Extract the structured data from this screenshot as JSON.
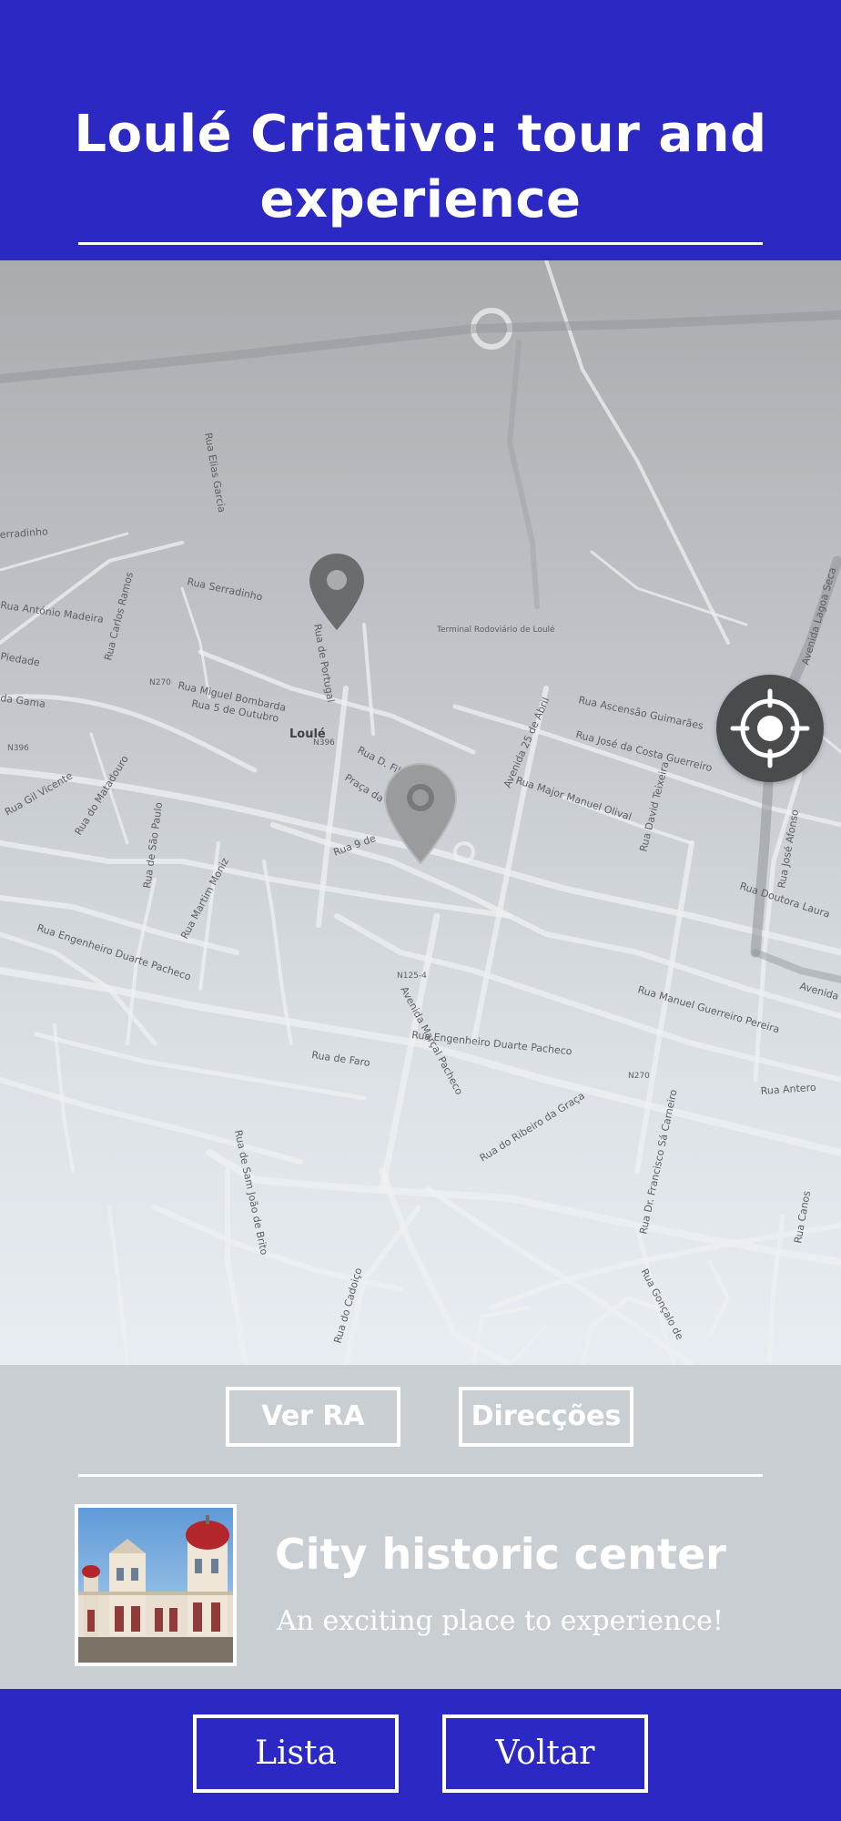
{
  "theme": {
    "brand_color": "#2b28c4",
    "map_pin_color": "#6b6c6e",
    "active_pin_color": "#9a9b9d"
  },
  "header": {
    "title": "Loulé Criativo: tour and experience"
  },
  "map": {
    "locate_icon": "crosshair-target-icon",
    "labels": {
      "town": "Loulé",
      "r_serradinho": "Rua Serradinho",
      "r_miguel_bombarda": "Rua Miguel Bombarda",
      "r_5_outubro": "Rua 5 de Outubro",
      "r_ascensao": "Rua Ascensão Guimarães",
      "r_jose_costa": "Rua José da Costa Guerreiro",
      "r_major_manuel": "Rua Major Manuel Olival",
      "r_david_teixeira": "Rua David Teixeira",
      "r_doutora": "Rua Doutora Laura",
      "r_engenheiro_1": "Rua Engenheiro Duarte Pacheco",
      "r_engenheiro_2": "Rua Engenheiro Duarte Pacheco",
      "r_manuel_guerreiro": "Rua Manuel Guerreiro Pereira",
      "r_antero": "Rua Antero",
      "r_faro": "Rua de Faro",
      "av_marcal": "Avenida Marçal Pacheco",
      "r_ribeiro": "Rua do Ribeiro da Graça",
      "r_sam_joao": "Rua de Sam João de Brito",
      "r_cadoico": "Rua do Cadoiço",
      "r_francisco": "Rua Dr. Francisco Sá Carneiro",
      "r_goncalo": "Rua Gonçalo de",
      "r_canos": "Rua Canos",
      "r_sao_paulo": "Rua de São Paulo",
      "r_martim": "Rua Martim Moniz",
      "r_matadouro": "Rua do Matadouro",
      "r_gil_vicente": "Rua Gil Vicente",
      "r_antonio": "Rua António Madeira",
      "r_carlos": "Rua Carlos Ramos",
      "r_portugal": "Rua de Portugal",
      "r_d_filipa": "Rua D. Filipa",
      "praca": "Praça da",
      "r_9": "Rua 9 de",
      "av_25": "Avenida 25 de Abril",
      "av_jose_afonso": "Rua José Afonso",
      "av_lagoa": "Avenida Lagoa Seca",
      "terminal": "Terminal Rodoviário de Loulé",
      "n270_a": "N270",
      "n396": "N396",
      "n125": "N125-4",
      "n270_b": "N270",
      "n396_b": "N396",
      "piedade": "Piedade",
      "gama": "da Gama",
      "serradinho_left": "erradinho",
      "avenida_right": "Avenida",
      "rua_left": "Rua Elias Garcia"
    }
  },
  "card": {
    "ar_button": "Ver RA",
    "directions_button": "Direcções",
    "place_title": "City historic center",
    "place_description": "An exciting place to experience!"
  },
  "footer": {
    "list_button": "Lista",
    "back_button": "Voltar"
  }
}
